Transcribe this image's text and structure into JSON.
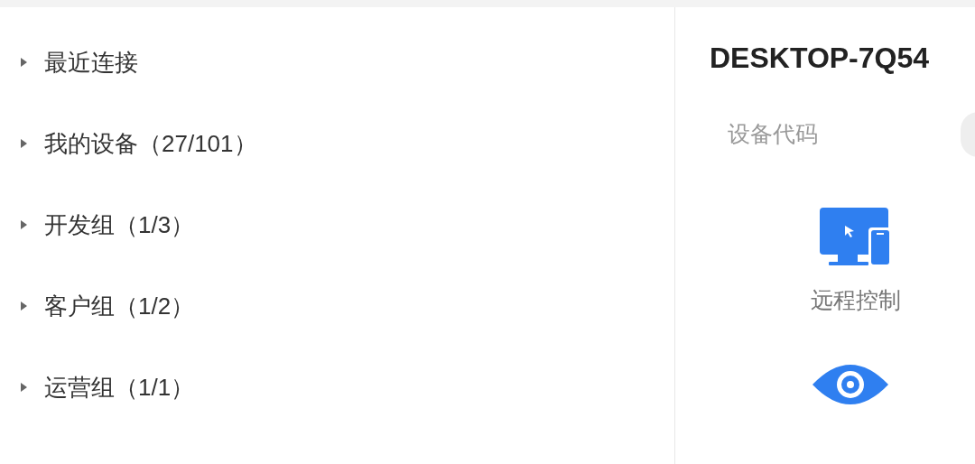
{
  "groups": [
    {
      "label": "最近连接",
      "expanded": false
    },
    {
      "label": "我的设备（27/101）",
      "expanded": false
    },
    {
      "label": "开发组（1/3）",
      "expanded": false
    },
    {
      "label": "客户组（1/2）",
      "expanded": false
    },
    {
      "label": "运营组（1/1）",
      "expanded": false
    }
  ],
  "device": {
    "title": "DESKTOP-7Q54",
    "code_label": "设备代码"
  },
  "actions": [
    {
      "kind": "remote",
      "label": "远程控制"
    },
    {
      "kind": "view"
    }
  ]
}
